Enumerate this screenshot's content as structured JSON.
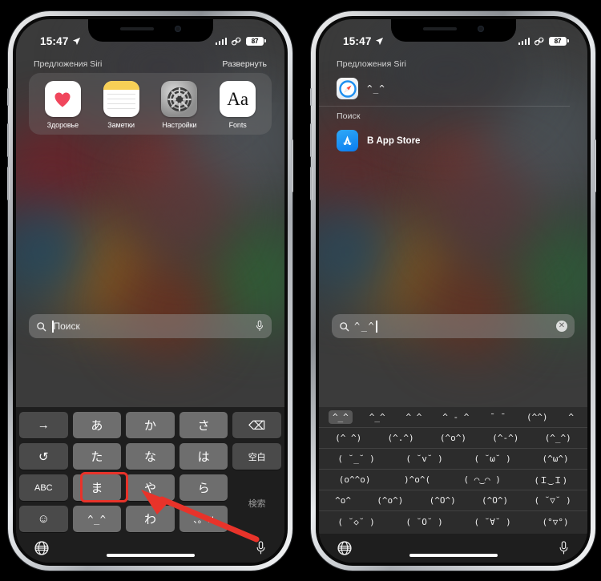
{
  "meta": {
    "accent_red": "#e8332a",
    "key_bg": "#6e6e6e",
    "kb_bg": "#1e1e1e"
  },
  "status_bar": {
    "time": "15:47",
    "location_icon": "location-arrow-icon",
    "signal_icon": "cellular-signal-icon",
    "connection_icon": "sim-link-icon",
    "battery_level": "87"
  },
  "left_phone": {
    "siri": {
      "section_label": "Предложения Siri",
      "expand_label": "Развернуть",
      "apps": [
        {
          "label": "Здоровье",
          "icon": "health-heart-icon"
        },
        {
          "label": "Заметки",
          "icon": "notes-icon"
        },
        {
          "label": "Настройки",
          "icon": "settings-gear-icon"
        },
        {
          "label": "Fonts",
          "icon": "fonts-aa-icon",
          "glyph": "Aa"
        }
      ]
    },
    "search": {
      "placeholder": "Поиск",
      "value": "",
      "search_icon": "search-icon",
      "mic_icon": "microphone-icon"
    },
    "keyboard": {
      "rows": [
        [
          {
            "label": "→",
            "style": "dark",
            "name": "key-arrow-right"
          },
          {
            "label": "あ",
            "style": "",
            "name": "key-a"
          },
          {
            "label": "か",
            "style": "",
            "name": "key-ka"
          },
          {
            "label": "さ",
            "style": "",
            "name": "key-sa"
          },
          {
            "label": "⌫",
            "style": "dark",
            "name": "key-backspace"
          }
        ],
        [
          {
            "label": "↺",
            "style": "dark",
            "name": "key-undo"
          },
          {
            "label": "た",
            "style": "",
            "name": "key-ta"
          },
          {
            "label": "な",
            "style": "",
            "name": "key-na"
          },
          {
            "label": "は",
            "style": "",
            "name": "key-ha"
          },
          {
            "label": "空白",
            "style": "dark small",
            "name": "key-space"
          }
        ],
        [
          {
            "label": "ABC",
            "style": "dark small",
            "name": "key-abc"
          },
          {
            "label": "ま",
            "style": "",
            "name": "key-ma"
          },
          {
            "label": "や",
            "style": "",
            "name": "key-ya"
          },
          {
            "label": "ら",
            "style": "",
            "name": "key-ra"
          },
          {
            "label": "検索",
            "style": "flat small",
            "name": "key-search"
          }
        ],
        [
          {
            "label": "☺",
            "style": "dark",
            "name": "key-emoji"
          },
          {
            "label": "^_^",
            "style": "mono",
            "name": "key-kaomoji",
            "highlighted": true
          },
          {
            "label": "わ",
            "style": "",
            "name": "key-wa"
          },
          {
            "label": "、。?!",
            "style": "small",
            "name": "key-punctuation"
          },
          {
            "label": "",
            "style": "flat",
            "name": "key-spacer"
          }
        ]
      ],
      "globe_icon": "globe-icon",
      "mic_icon": "microphone-icon"
    }
  },
  "right_phone": {
    "siri": {
      "section_label": "Предложения Siri",
      "result": {
        "text": "^_^",
        "icon": "safari-icon"
      }
    },
    "search_section": {
      "section_label": "Поиск",
      "result": {
        "text": "В App Store",
        "icon": "app-store-icon"
      }
    },
    "search": {
      "value": "^_^",
      "placeholder": "Поиск",
      "search_icon": "search-icon",
      "clear_icon": "clear-circle-icon",
      "clear_glyph": "✕"
    },
    "kaomoji_rows": [
      [
        "^_^",
        "^_^",
        "^ ^",
        "^ - ^",
        "¯ ¯",
        "(^^)",
        "^"
      ],
      [
        "(^ ^)",
        "(^.^)",
        "(^o^)",
        "(^-^)",
        "(^_^)"
      ],
      [
        "( ˘_˘ )",
        "( ˘v˘ )",
        "( ˘ω˘ )",
        "(^ω^)"
      ],
      [
        "(o^^o)",
        ")^o^(",
        "( ⌒‿⌒ )",
        "(Ｉ‿Ｉ)"
      ],
      [
        "^o^",
        "(^o^)",
        "(^O^)",
        "(^O^)",
        "( ˘▽˘ )"
      ],
      [
        "( ˘◇˘ )",
        "( ˘O˘ )",
        "( ˘∀˘ )",
        "(°▽°)"
      ]
    ],
    "keyboard": {
      "globe_icon": "globe-icon",
      "mic_icon": "microphone-icon"
    }
  },
  "annotations": {
    "highlight_label": "kaomoji-key-highlight",
    "arrow_label": "pointer-arrow"
  }
}
